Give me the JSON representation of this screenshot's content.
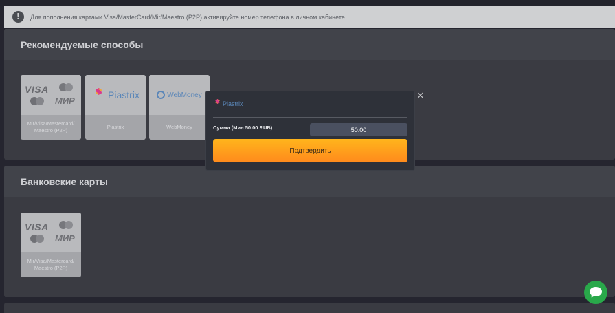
{
  "notice": {
    "icon": "exclamation-icon",
    "text": "Для пополнения картами Visa/MasterCard/Mir/Maestro (P2P) активируйте номер телефона в личном кабинете."
  },
  "recommended": {
    "title": "Рекомендуемые способы",
    "methods": [
      {
        "label": "Mir/Visa/Mastercard/ Maestro (P2P)",
        "logo_visa": "VISA",
        "logo_mir": "МИР"
      },
      {
        "label": "Piastrix",
        "logo_text": "Piastrix"
      },
      {
        "label": "WebMoney",
        "logo_text": "WebMoney"
      }
    ]
  },
  "bank_cards": {
    "title": "Банковские карты",
    "methods": [
      {
        "label": "Mir/Visa/Mastercard/ Maestro (P2P)",
        "logo_visa": "VISA",
        "logo_mir": "МИР"
      }
    ]
  },
  "modal": {
    "brand": "Piastrix",
    "close_glyph": "×",
    "amount_label": "Сумма (Мин 50.00 RUB):",
    "amount_value": "50.00",
    "confirm_label": "Подтвердить"
  },
  "colors": {
    "accent": "#ffa01c",
    "chat": "#29a84a"
  },
  "chat": {
    "icon": "chat-bubble-icon"
  }
}
